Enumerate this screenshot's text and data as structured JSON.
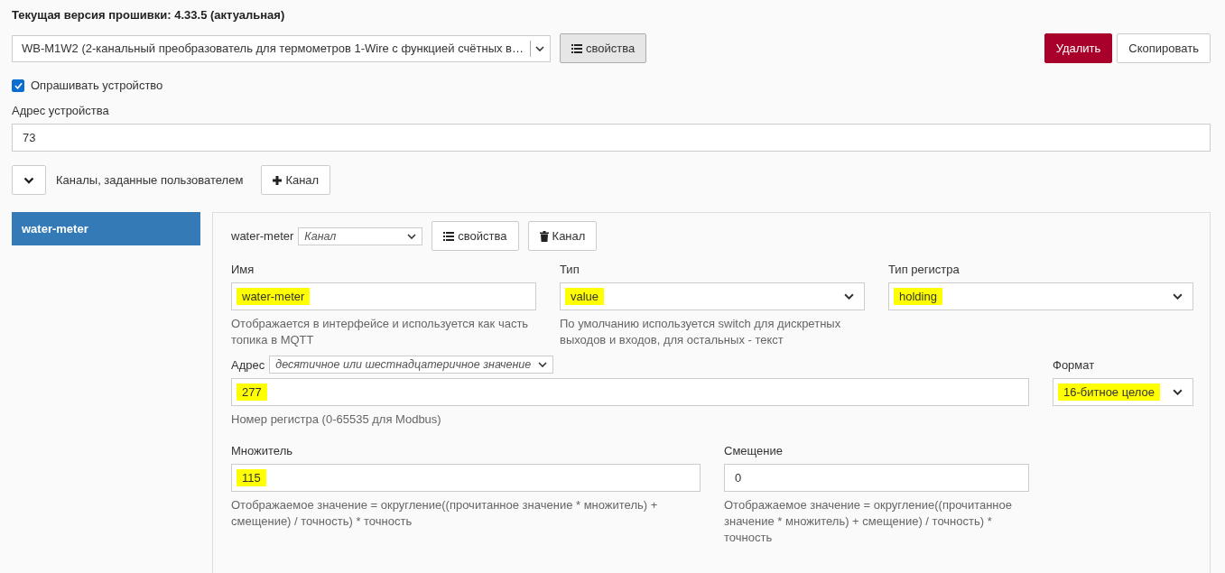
{
  "firmware": {
    "label": "Текущая версия прошивки:",
    "value": "4.33.5 (актуальная)"
  },
  "device_select": {
    "value": "WB-M1W2 (2-канальный преобразователь для термометров 1-Wire с функцией счётных в…"
  },
  "properties_button": "свойства",
  "actions": [
    {
      "label": "Удалить",
      "kind": "danger"
    },
    {
      "label": "Скопировать",
      "kind": "default"
    }
  ],
  "poll": {
    "label": "Опрашивать устройство",
    "checked": true
  },
  "address": {
    "label": "Адрес устройства",
    "value": "73"
  },
  "channels_bar": {
    "label": "Каналы, заданные пользователем",
    "add_button": "Канал",
    "expanded": true
  },
  "sidebar": {
    "items": [
      {
        "label": "water-meter",
        "selected": true
      }
    ]
  },
  "channel": {
    "name": "water-meter",
    "type_select": "Канал",
    "properties_button": "свойства",
    "delete_button": "Канал",
    "rows": [
      [
        {
          "label": "Имя",
          "value": "water-meter",
          "kind": "text",
          "highlighted": true,
          "help": "Отображается в интерфейсе и используется как часть топика в MQTT"
        },
        {
          "label": "Тип",
          "value": "value",
          "kind": "select",
          "highlighted": true,
          "help": "По умолчанию используется switch для дискретных выходов и входов, для остальных - текст"
        },
        {
          "label": "Тип регистра",
          "value": "holding",
          "kind": "select",
          "highlighted": true
        }
      ],
      [
        {
          "label": "Адрес",
          "mode": "десятичное или шестнадцатеричное значение",
          "value": "277",
          "kind": "text",
          "highlighted": true,
          "help": "Номер регистра (0-65535 для Modbus)"
        },
        {
          "label": "Формат",
          "value": "16-битное целое",
          "kind": "select",
          "highlighted": true
        }
      ],
      [
        {
          "label": "Множитель",
          "value": "115",
          "kind": "text",
          "highlighted": true,
          "help": "Отображаемое значение = округление((прочитанное значение * множитель) + смещение) / точность) * точность"
        },
        {
          "label": "Смещение",
          "value": "0",
          "kind": "text",
          "highlighted": false,
          "help": "Отображаемое значение = округление((прочитанное значение * множитель) + смещение) / точность) * точность"
        }
      ]
    ]
  }
}
